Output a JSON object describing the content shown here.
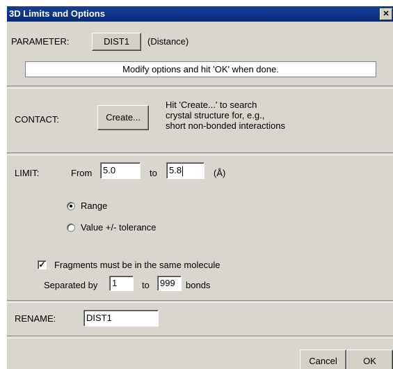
{
  "window": {
    "title": "3D Limits and Options",
    "close_glyph": "✕"
  },
  "parameter": {
    "label": "PARAMETER:",
    "name_button": "DIST1",
    "type": "(Distance)"
  },
  "info_text": "Modify options and hit 'OK' when done.",
  "contact": {
    "label": "CONTACT:",
    "create_button": "Create...",
    "help_lines": [
      "Hit 'Create...' to search",
      "crystal structure for, e.g.,",
      "short non-bonded interactions"
    ]
  },
  "limit": {
    "label": "LIMIT:",
    "from_label": "From",
    "from_value": "5.0",
    "to_label": "to",
    "to_value": "5.8",
    "unit": "(Å)",
    "mode_options": [
      {
        "label": "Range",
        "selected": true
      },
      {
        "label": "Value +/- tolerance",
        "selected": false
      }
    ]
  },
  "fragments": {
    "same_molecule_label": "Fragments must be in the same molecule",
    "same_molecule_checked": true,
    "check_glyph": "✓",
    "separated_label": "Separated by",
    "min_bonds": "1",
    "to_label": "to",
    "max_bonds": "999",
    "bonds_label": "bonds"
  },
  "rename": {
    "label": "RENAME:",
    "value": "DIST1"
  },
  "footer": {
    "cancel_button": "Cancel",
    "ok_button": "OK"
  }
}
